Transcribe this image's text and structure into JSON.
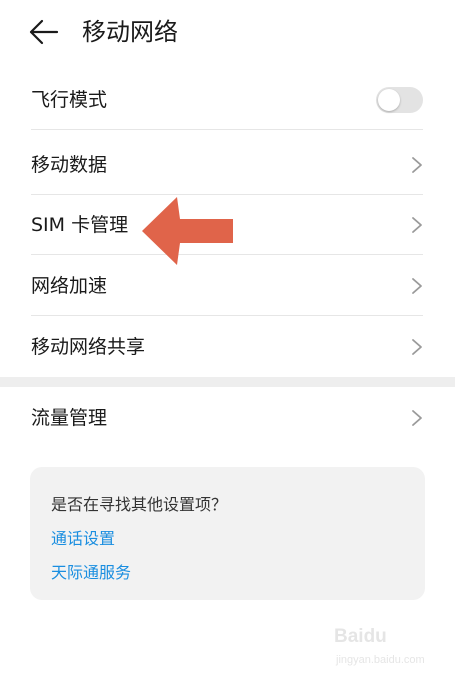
{
  "header": {
    "title": "移动网络",
    "back_icon": "arrow-left-icon"
  },
  "rows": [
    {
      "label": "飞行模式",
      "control": "toggle",
      "on": false
    },
    {
      "label": "移动数据",
      "control": "chevron"
    },
    {
      "label": "SIM 卡管理",
      "control": "chevron"
    },
    {
      "label": "网络加速",
      "control": "chevron"
    },
    {
      "label": "移动网络共享",
      "control": "chevron"
    }
  ],
  "traffic_row": {
    "label": "流量管理",
    "control": "chevron"
  },
  "suggestions": {
    "title": "是否在寻找其他设置项？",
    "links": [
      "通话设置",
      "天际通服务"
    ]
  },
  "annotation": {
    "icon": "arrow-left-icon",
    "color": "#e0644a",
    "points_to": "SIM 卡管理"
  },
  "watermark": {
    "brand": "Baidu",
    "url": "jingyan.baidu.com"
  },
  "colors": {
    "link": "#1a8ee0",
    "divider": "#e6e6e6",
    "card": "#f2f2f2",
    "section_gap": "#eeeeee",
    "arrow": "#e0644a"
  }
}
